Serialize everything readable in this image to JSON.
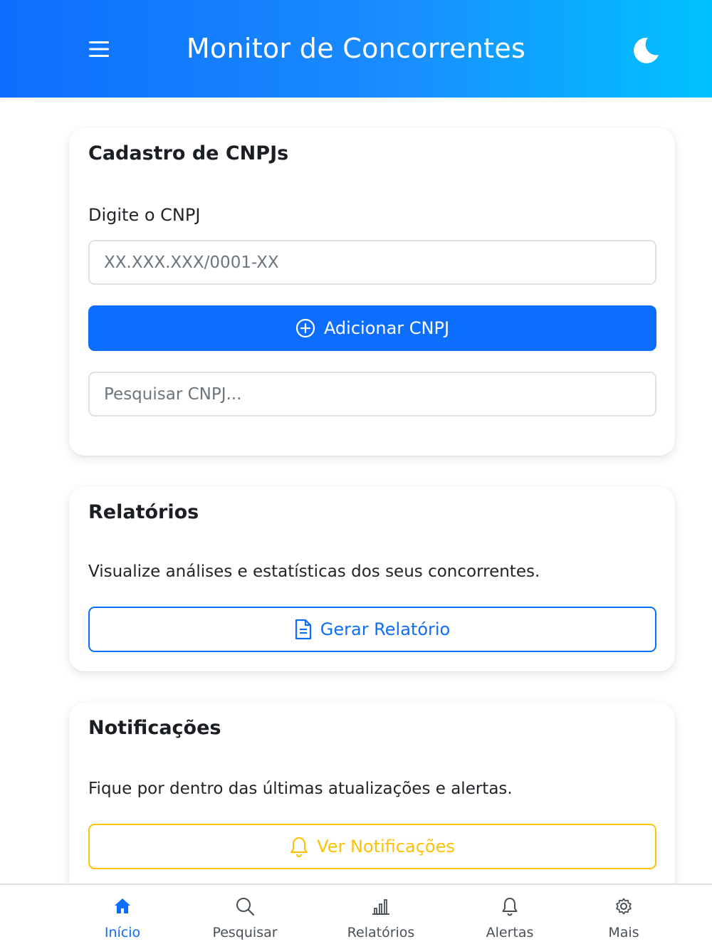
{
  "header": {
    "title": "Monitor de Concorrentes",
    "menu_icon": "hamburger-icon",
    "theme_icon": "moon-icon"
  },
  "cnpj_card": {
    "title": "Cadastro de CNPJs",
    "input_label": "Digite o CNPJ",
    "input_placeholder": "XX.XXX.XXX/0001-XX",
    "add_button_label": "Adicionar CNPJ",
    "search_placeholder": "Pesquisar CNPJ..."
  },
  "reports_card": {
    "title": "Relatórios",
    "description": "Visualize análises e estatísticas dos seus concorrentes.",
    "button_label": "Gerar Relatório"
  },
  "notifications_card": {
    "title": "Notificações",
    "description": "Fique por dentro das últimas atualizações e alertas.",
    "button_label": "Ver Notificações"
  },
  "bottom_nav": {
    "items": [
      {
        "label": "Início",
        "icon": "home-icon",
        "active": true
      },
      {
        "label": "Pesquisar",
        "icon": "search-icon",
        "active": false
      },
      {
        "label": "Relatórios",
        "icon": "bar-chart-icon",
        "active": false
      },
      {
        "label": "Alertas",
        "icon": "bell-icon",
        "active": false
      },
      {
        "label": "Mais",
        "icon": "gear-icon",
        "active": false
      }
    ]
  },
  "colors": {
    "primary": "#0d6efd",
    "warning": "#ffc107",
    "header_gradient_start": "#0d6efd",
    "header_gradient_end": "#00c2ff"
  }
}
